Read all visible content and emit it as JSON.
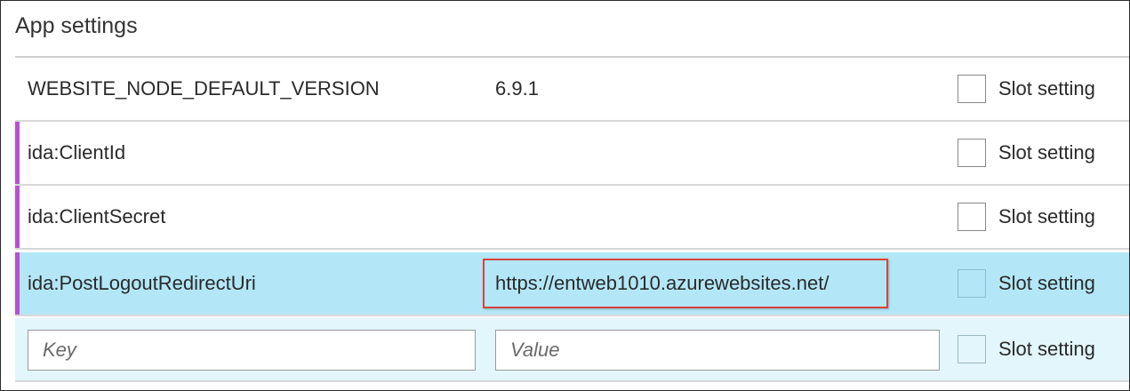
{
  "section": {
    "title": "App settings"
  },
  "settings": [
    {
      "key": "WEBSITE_NODE_DEFAULT_VERSION",
      "value": "6.9.1",
      "slot_label": "Slot setting",
      "slot_checked": false
    },
    {
      "key": "ida:ClientId",
      "value": "",
      "slot_label": "Slot setting",
      "slot_checked": false
    },
    {
      "key": "ida:ClientSecret",
      "value": "",
      "slot_label": "Slot setting",
      "slot_checked": false
    },
    {
      "key": "ida:PostLogoutRedirectUri",
      "value": "https://entweb1010.azurewebsites.net/",
      "slot_label": "Slot setting",
      "slot_checked": false
    }
  ],
  "new_setting": {
    "key_placeholder": "Key",
    "value_placeholder": "Value",
    "slot_label": "Slot setting"
  },
  "colors": {
    "modified_marker": "#b94fd3",
    "selected_row": "#b3e7f7",
    "new_row": "#e2f6fc",
    "highlight_box": "#d9443c"
  }
}
